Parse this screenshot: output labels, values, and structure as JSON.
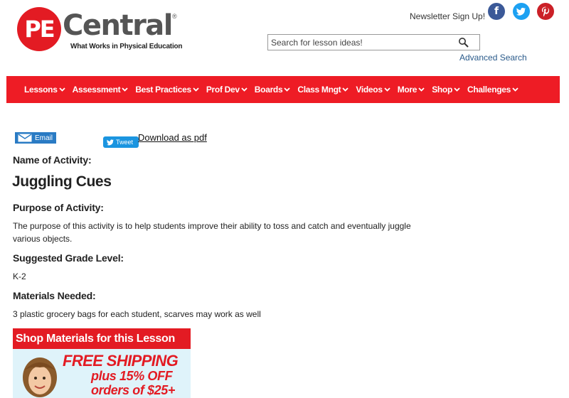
{
  "header": {
    "logo_pe": "PE",
    "logo_word": "Central",
    "logo_reg": "®",
    "logo_tagline": "What Works in Physical Education",
    "newsletter": "Newsletter Sign Up!",
    "social": {
      "facebook": "f",
      "twitter": "t",
      "pinterest": "p"
    },
    "search_placeholder": "Search for lesson ideas!",
    "advanced_search": "Advanced Search"
  },
  "nav": {
    "items": [
      "Lessons",
      "Assessment",
      "Best Practices",
      "Prof Dev",
      "Boards",
      "Class Mngt",
      "Videos",
      "More",
      "Shop",
      "Challenges"
    ]
  },
  "share": {
    "email": "Email",
    "tweet": "Tweet",
    "pdf": "Download as pdf"
  },
  "content": {
    "name_label": "Name of Activity:",
    "name_value": "Juggling Cues",
    "purpose_label": "Purpose of Activity:",
    "purpose_value": "The purpose of this activity is to help students improve their ability to toss and catch and eventually juggle various objects.",
    "grade_label": "Suggested Grade Level:",
    "grade_value": "K-2",
    "materials_label": "Materials Needed:",
    "materials_value": "3 plastic grocery bags for each student, scarves may work as well"
  },
  "ad": {
    "heading": "Shop Materials for this Lesson",
    "free": "FREE SHIPPING",
    "plus": "plus 15% OFF",
    "orders": "orders of $25+"
  },
  "colors": {
    "brand_red": "#ee1c25",
    "link_blue": "#2a5a8a",
    "facebook": "#3b5998",
    "twitter": "#1da1f2",
    "pinterest": "#cb2027"
  }
}
